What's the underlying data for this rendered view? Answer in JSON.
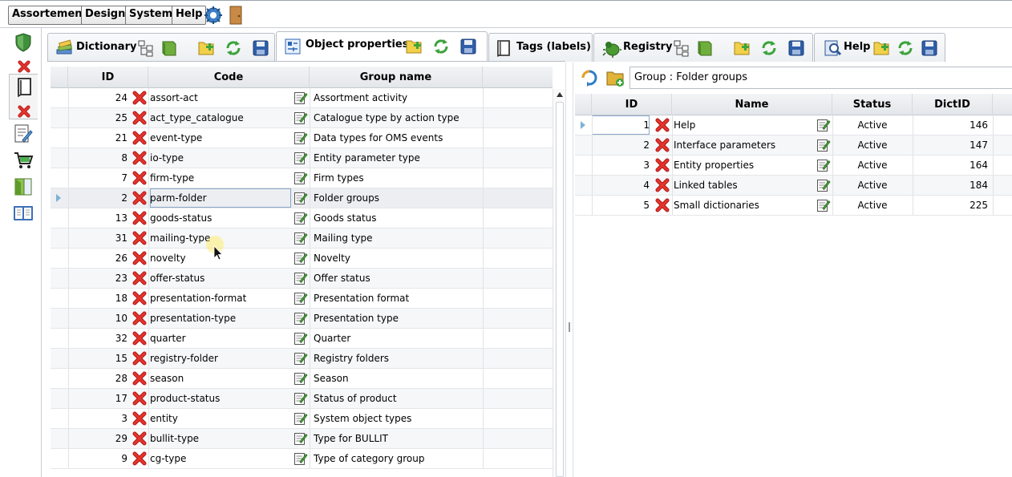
{
  "menu": [
    "Assortement",
    "Design",
    "System",
    "Help"
  ],
  "tabs": {
    "dictionary": "Dictionary",
    "object_properties": "Object properties",
    "tags": "Tags (labels)",
    "registry": "Registry",
    "help": "Help"
  },
  "left_grid": {
    "columns": {
      "id": "ID",
      "code": "Code",
      "group_name": "Group name"
    },
    "selected_id": 2,
    "rows": [
      {
        "id": "24",
        "code": "assort-act",
        "group_name": "Assortment activity"
      },
      {
        "id": "25",
        "code": "act_type_catalogue",
        "group_name": "Catalogue type by action type"
      },
      {
        "id": "21",
        "code": "event-type",
        "group_name": "Data types for OMS events"
      },
      {
        "id": "8",
        "code": "io-type",
        "group_name": "Entity parameter type"
      },
      {
        "id": "7",
        "code": "firm-type",
        "group_name": "Firm types"
      },
      {
        "id": "2",
        "code": "parm-folder",
        "group_name": "Folder groups"
      },
      {
        "id": "13",
        "code": "goods-status",
        "group_name": "Goods status"
      },
      {
        "id": "31",
        "code": "mailing-type",
        "group_name": "Mailing type"
      },
      {
        "id": "26",
        "code": "novelty",
        "group_name": "Novelty"
      },
      {
        "id": "23",
        "code": "offer-status",
        "group_name": "Offer status"
      },
      {
        "id": "18",
        "code": "presentation-format",
        "group_name": "Presentation format"
      },
      {
        "id": "10",
        "code": "presentation-type",
        "group_name": "Presentation type"
      },
      {
        "id": "32",
        "code": "quarter",
        "group_name": "Quarter"
      },
      {
        "id": "15",
        "code": "registry-folder",
        "group_name": "Registry folders"
      },
      {
        "id": "28",
        "code": "season",
        "group_name": "Season"
      },
      {
        "id": "17",
        "code": "product-status",
        "group_name": "Status of product"
      },
      {
        "id": "3",
        "code": "entity",
        "group_name": "System object types"
      },
      {
        "id": "29",
        "code": "bullit-type",
        "group_name": "Type for BULLIT"
      },
      {
        "id": "9",
        "code": "cg-type",
        "group_name": "Type of category group"
      }
    ]
  },
  "right_panel": {
    "group_label": "Group : Folder groups",
    "columns": {
      "id": "ID",
      "name": "Name",
      "status": "Status",
      "dict_id": "DictID"
    },
    "rows": [
      {
        "id": "1",
        "name": "Help",
        "status": "Active",
        "dict_id": "146"
      },
      {
        "id": "2",
        "name": "Interface parameters",
        "status": "Active",
        "dict_id": "147"
      },
      {
        "id": "3",
        "name": "Entity properties",
        "status": "Active",
        "dict_id": "164"
      },
      {
        "id": "4",
        "name": "Linked tables",
        "status": "Active",
        "dict_id": "184"
      },
      {
        "id": "5",
        "name": "Small dictionaries",
        "status": "Active",
        "dict_id": "225"
      }
    ]
  },
  "colors": {
    "delete_red": "#d9261c",
    "row_marker": "#7fb1d6",
    "add_yellow": "#f3d94a",
    "refresh_green": "#3aa33a"
  }
}
